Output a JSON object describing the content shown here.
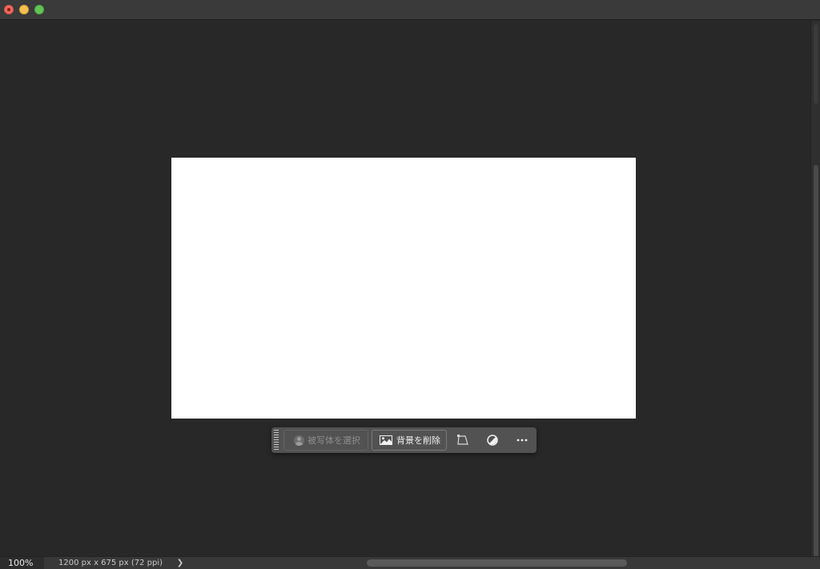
{
  "toolbar": {
    "select_subject_label": "被写体を選択",
    "remove_background_label": "背景を削除",
    "icons": {
      "select_subject": "person-icon",
      "remove_background": "image-icon",
      "transform": "free-transform-icon",
      "adjustment": "adjustment-circle-icon",
      "more": "ellipsis-icon"
    }
  },
  "status_bar": {
    "zoom": "100%",
    "document_info": "1200 px x 675 px (72 ppi)",
    "expand_arrow": "❯"
  },
  "colors": {
    "workspace_bg": "#282828",
    "document_bg": "#ffffff",
    "taskbar_bg": "#525252",
    "close": "#ed6a5e",
    "minimize": "#f5bf4f",
    "zoom": "#61c554"
  }
}
